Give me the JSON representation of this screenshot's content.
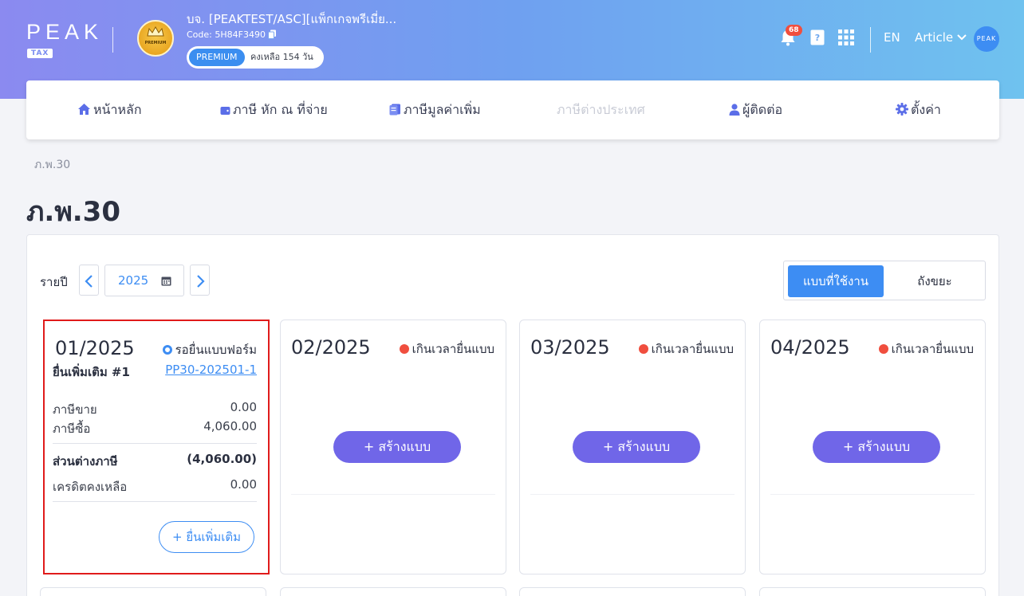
{
  "header": {
    "logo": "PEAK",
    "logo_sub": "TAX",
    "company_name": "บจ. [PEAKTEST/ASC][แพ็กเกจพรีเมี่ย...",
    "company_code": "Code: 5H84F3490",
    "badge_text": "PREMIUM",
    "plan": "PREMIUM",
    "plan_remaining": "คงเหลือ 154 วัน",
    "notification_count": "68",
    "language": "EN",
    "user_name": "Article",
    "avatar_text": "PEAK"
  },
  "nav": {
    "items": [
      {
        "label": "หน้าหลัก",
        "icon": "home-icon"
      },
      {
        "label": "ภาษี หัก ณ ที่จ่าย",
        "icon": "wallet-icon"
      },
      {
        "label": "ภาษีมูลค่าเพิ่ม",
        "icon": "document-icon"
      },
      {
        "label": "ภาษีต่างประเทศ",
        "icon": null
      },
      {
        "label": "ผู้ติดต่อ",
        "icon": "user-icon"
      },
      {
        "label": "ตั้งค่า",
        "icon": "gear-icon"
      }
    ]
  },
  "breadcrumb": "ภ.พ.30",
  "page_title": "ภ.พ.30",
  "filter": {
    "period_label": "รายปี",
    "year": "2025",
    "tab_active": "แบบที่ใช้งาน",
    "tab_other": "ถังขยะ"
  },
  "cards": [
    {
      "month": "01/2025",
      "status": "รอยื่นแบบฟอร์ม",
      "sub_title": "ยื่นเพิ่มเติม #1",
      "doc_link": "PP30-202501-1",
      "sales_tax_label": "ภาษีขาย",
      "sales_tax": "0.00",
      "purchase_tax_label": "ภาษีซื้อ",
      "purchase_tax": "4,060.00",
      "diff_label": "ส่วนต่างภาษี",
      "diff": "(4,060.00)",
      "credit_label": "เครดิตคงเหลือ",
      "credit": "0.00",
      "action": "ยื่นเพิ่มเติม"
    },
    {
      "month": "02/2025",
      "status": "เกินเวลายื่นแบบ",
      "action": "สร้างแบบ"
    },
    {
      "month": "03/2025",
      "status": "เกินเวลายื่นแบบ",
      "action": "สร้างแบบ"
    },
    {
      "month": "04/2025",
      "status": "เกินเวลายื่นแบบ",
      "action": "สร้างแบบ"
    }
  ],
  "colors": {
    "accent": "#3d8df3",
    "create_button": "#7066e8",
    "overdue_dot": "#f04e3e",
    "highlight_border": "#e01b1b"
  }
}
